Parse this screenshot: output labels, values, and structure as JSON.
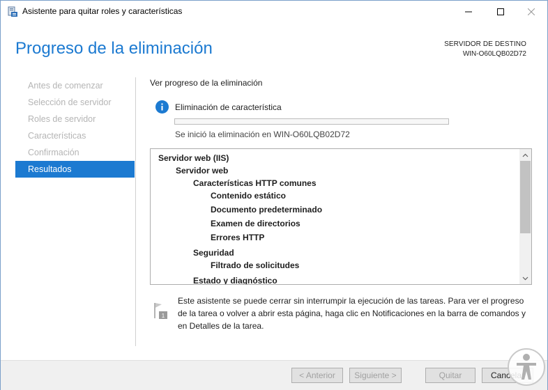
{
  "window": {
    "title": "Asistente para quitar roles y características"
  },
  "header": {
    "title": "Progreso de la eliminación",
    "destination_label": "SERVIDOR DE DESTINO",
    "destination_value": "WIN-O60LQB02D72"
  },
  "nav": {
    "items": [
      {
        "label": "Antes de comenzar"
      },
      {
        "label": "Selección de servidor"
      },
      {
        "label": "Roles de servidor"
      },
      {
        "label": "Características"
      },
      {
        "label": "Confirmación"
      },
      {
        "label": "Resultados"
      }
    ],
    "active_index": 5
  },
  "main": {
    "section_title": "Ver progreso de la eliminación",
    "status_title": "Eliminación de característica",
    "progress": 0.0,
    "status_sub": "Se inició la eliminación en WIN-O60LQB02D72",
    "list": [
      {
        "text": "Servidor web (IIS)",
        "level": 0
      },
      {
        "text": "Servidor web",
        "level": 1
      },
      {
        "text": "Características HTTP comunes",
        "level": 2
      },
      {
        "text": "Contenido estático",
        "level": 3
      },
      {
        "text": "Documento predeterminado",
        "level": 3
      },
      {
        "text": "Examen de directorios",
        "level": 3
      },
      {
        "text": "Errores HTTP",
        "level": 3
      },
      {
        "text": "Seguridad",
        "level": 2
      },
      {
        "text": "Filtrado de solicitudes",
        "level": 3
      },
      {
        "text": "Estado y diagnóstico",
        "level": 2
      }
    ],
    "note": "Este asistente se puede cerrar sin interrumpir la ejecución de las tareas. Para ver el progreso de la tarea o volver a abrir esta página, haga clic en Notificaciones en la barra de comandos y en Detalles de la tarea."
  },
  "footer": {
    "prev_label": "< Anterior",
    "next_label": "Siguiente >",
    "quit_label": "Quitar",
    "cancel_label": "Cancelar"
  },
  "colors": {
    "accent": "#1c7ad1",
    "progress_fill": "#06b025"
  }
}
